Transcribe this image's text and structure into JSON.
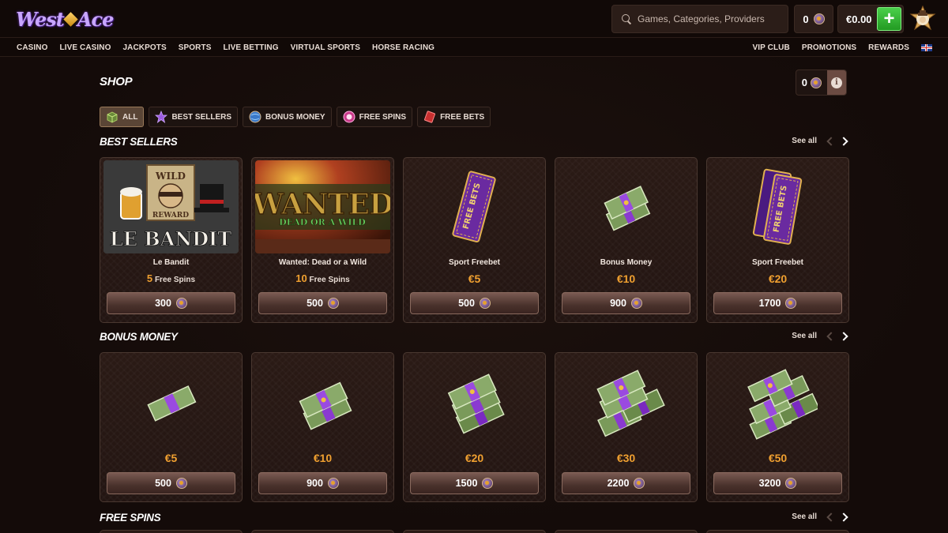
{
  "header": {
    "logo_left": "West",
    "logo_right": "Ace",
    "search_placeholder": "Games, Categories, Providers",
    "coin_count": "0",
    "balance": "€0.00"
  },
  "nav": {
    "left": [
      "CASINO",
      "LIVE CASINO",
      "JACKPOTS",
      "SPORTS",
      "LIVE BETTING",
      "VIRTUAL SPORTS",
      "HORSE RACING"
    ],
    "right": [
      "VIP CLUB",
      "PROMOTIONS",
      "REWARDS"
    ]
  },
  "shop": {
    "title": "SHOP",
    "coins": "0",
    "filters": [
      {
        "label": "ALL",
        "icon": "box-icon"
      },
      {
        "label": "BEST SELLERS",
        "icon": "star-icon"
      },
      {
        "label": "BONUS MONEY",
        "icon": "globe-coin-icon"
      },
      {
        "label": "FREE SPINS",
        "icon": "spin-chip-icon"
      },
      {
        "label": "FREE BETS",
        "icon": "ticket-icon"
      }
    ]
  },
  "sections": {
    "best_sellers": {
      "title": "BEST SELLERS",
      "see_all": "See all",
      "items": [
        {
          "name": "Le Bandit",
          "amount": "5",
          "unit": "Free Spins",
          "price": "300",
          "image": "le-bandit-art"
        },
        {
          "name": "Wanted: Dead or a Wild",
          "amount": "10",
          "unit": "Free Spins",
          "price": "500",
          "image": "wanted-art"
        },
        {
          "name": "Sport Freebet",
          "value": "€5",
          "price": "500",
          "image": "freebet-ticket"
        },
        {
          "name": "Bonus Money",
          "value": "€10",
          "price": "900",
          "image": "cash-stack"
        },
        {
          "name": "Sport Freebet",
          "value": "€20",
          "price": "1700",
          "image": "freebet-tickets"
        }
      ]
    },
    "bonus_money": {
      "title": "BONUS MONEY",
      "see_all": "See all",
      "items": [
        {
          "value": "€5",
          "price": "500"
        },
        {
          "value": "€10",
          "price": "900"
        },
        {
          "value": "€20",
          "price": "1500"
        },
        {
          "value": "€30",
          "price": "2200"
        },
        {
          "value": "€50",
          "price": "3200"
        }
      ]
    },
    "free_spins": {
      "title": "FREE SPINS",
      "see_all": "See all"
    }
  },
  "colors": {
    "background": "#150c0a",
    "accent_orange": "#f0a030",
    "green_button": "#3bbf3b",
    "purple": "#8a4fd6"
  },
  "game_art": {
    "le_bandit": {
      "tag_top": "WILD",
      "tag_bottom": "REWARD",
      "logo": "LE BANDIT"
    },
    "wanted": {
      "logo": "WANTED",
      "sub": "DEAD OR A WILD"
    },
    "ticket_label": "FREE BETS"
  }
}
